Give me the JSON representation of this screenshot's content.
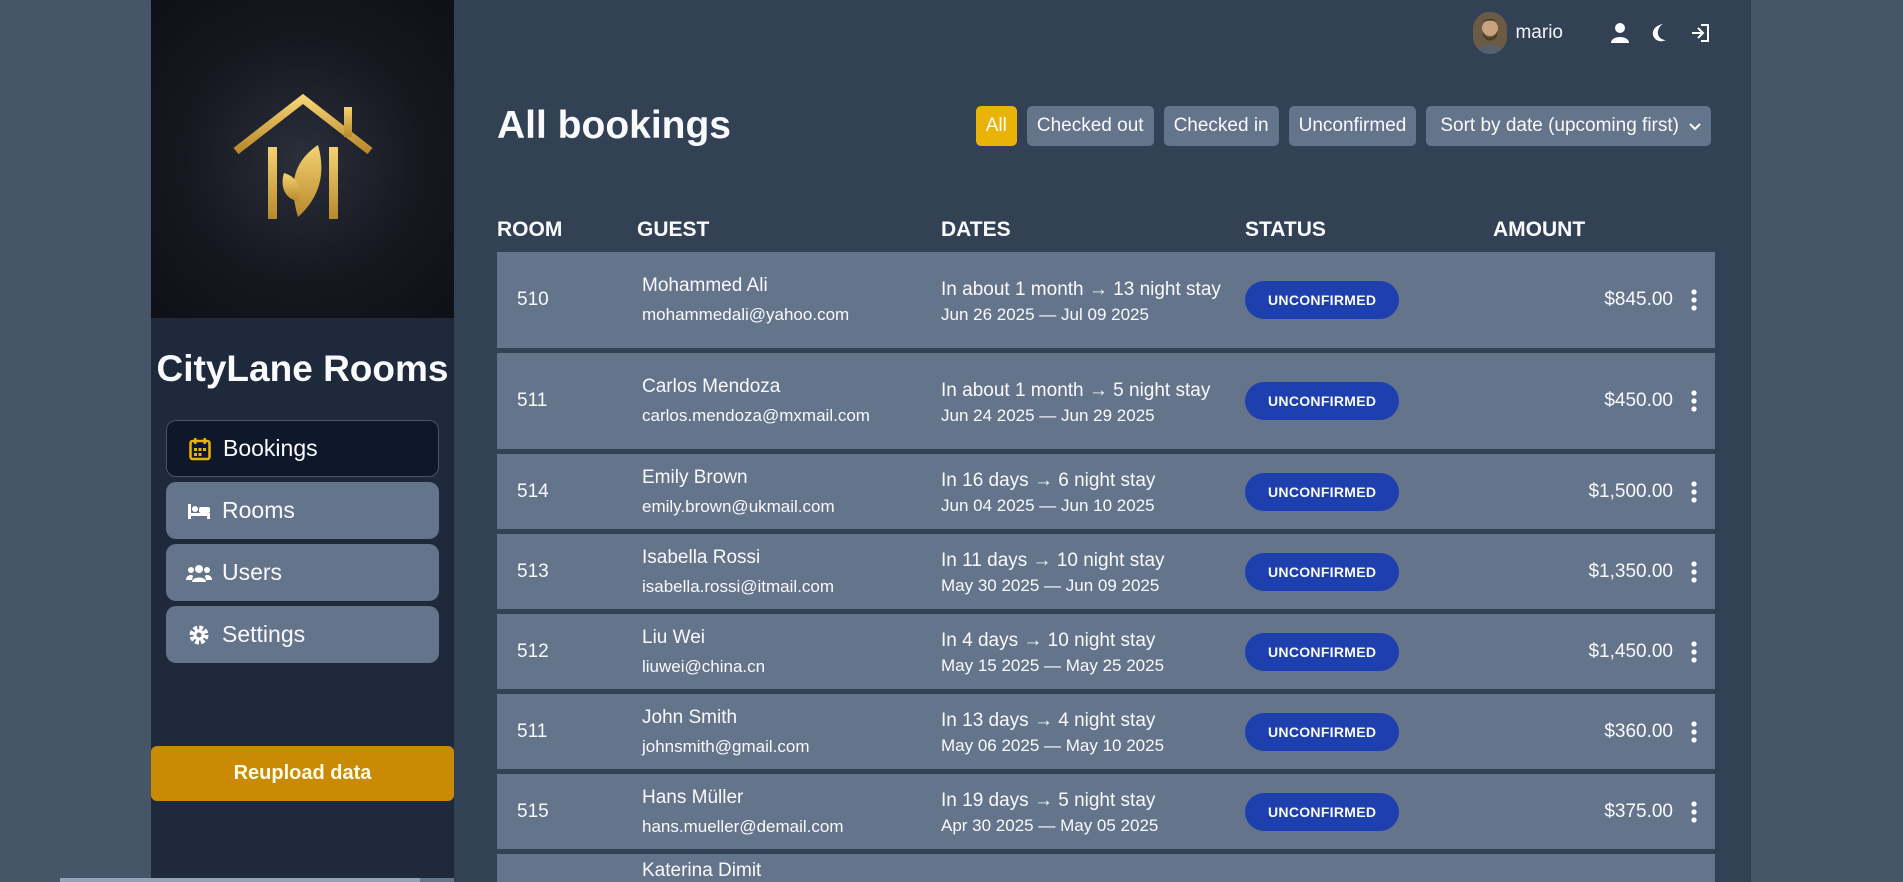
{
  "sidebar": {
    "brand": "CityLane Rooms",
    "nav": [
      {
        "label": "Bookings",
        "icon": "calendar-icon",
        "active": true
      },
      {
        "label": "Rooms",
        "icon": "bed-icon",
        "active": false
      },
      {
        "label": "Users",
        "icon": "users-icon",
        "active": false
      },
      {
        "label": "Settings",
        "icon": "gear-icon",
        "active": false
      }
    ],
    "reupload_label": "Reupload data"
  },
  "header": {
    "username": "mario",
    "icons": [
      "user-icon",
      "moon-icon",
      "logout-icon"
    ]
  },
  "page": {
    "title": "All bookings",
    "filters": [
      "All",
      "Checked out",
      "Checked in",
      "Unconfirmed"
    ],
    "active_filter": "All",
    "sort_label": "Sort by date (upcoming first)"
  },
  "table": {
    "headers": [
      "ROOM",
      "GUEST",
      "DATES",
      "STATUS",
      "AMOUNT"
    ],
    "rows": [
      {
        "room": "510",
        "name": "Mohammed Ali",
        "email": "mohammedali@yahoo.com",
        "when": "In about 1 month → 13 night stay",
        "range": "Jun 26 2025 — Jul 09 2025",
        "status": "UNCONFIRMED",
        "amount": "$845.00"
      },
      {
        "room": "511",
        "name": "Carlos Mendoza",
        "email": "carlos.mendoza@mxmail.com",
        "when": "In about 1 month → 5 night stay",
        "range": "Jun 24 2025 — Jun 29 2025",
        "status": "UNCONFIRMED",
        "amount": "$450.00"
      },
      {
        "room": "514",
        "name": "Emily Brown",
        "email": "emily.brown@ukmail.com",
        "when": "In 16 days → 6 night stay",
        "range": "Jun 04 2025 — Jun 10 2025",
        "status": "UNCONFIRMED",
        "amount": "$1,500.00"
      },
      {
        "room": "513",
        "name": "Isabella Rossi",
        "email": "isabella.rossi@itmail.com",
        "when": "In 11 days → 10 night stay",
        "range": "May 30 2025 — Jun 09 2025",
        "status": "UNCONFIRMED",
        "amount": "$1,350.00"
      },
      {
        "room": "512",
        "name": "Liu Wei",
        "email": "liuwei@china.cn",
        "when": "In 4 days → 10 night stay",
        "range": "May 15 2025 — May 25 2025",
        "status": "UNCONFIRMED",
        "amount": "$1,450.00"
      },
      {
        "room": "511",
        "name": "John Smith",
        "email": "johnsmith@gmail.com",
        "when": "In 13 days → 4 night stay",
        "range": "May 06 2025 — May 10 2025",
        "status": "UNCONFIRMED",
        "amount": "$360.00"
      },
      {
        "room": "515",
        "name": "Hans Müller",
        "email": "hans.mueller@demail.com",
        "when": "In 19 days → 5 night stay",
        "range": "Apr 30 2025 — May 05 2025",
        "status": "UNCONFIRMED",
        "amount": "$375.00"
      },
      {
        "room": "",
        "name": "Katerina Dimit",
        "email": "",
        "when": "",
        "range": "",
        "status": "",
        "amount": ""
      }
    ]
  },
  "colors": {
    "accent": "#eab308",
    "badge": "#1e40af",
    "reupload": "#ca8a04"
  }
}
